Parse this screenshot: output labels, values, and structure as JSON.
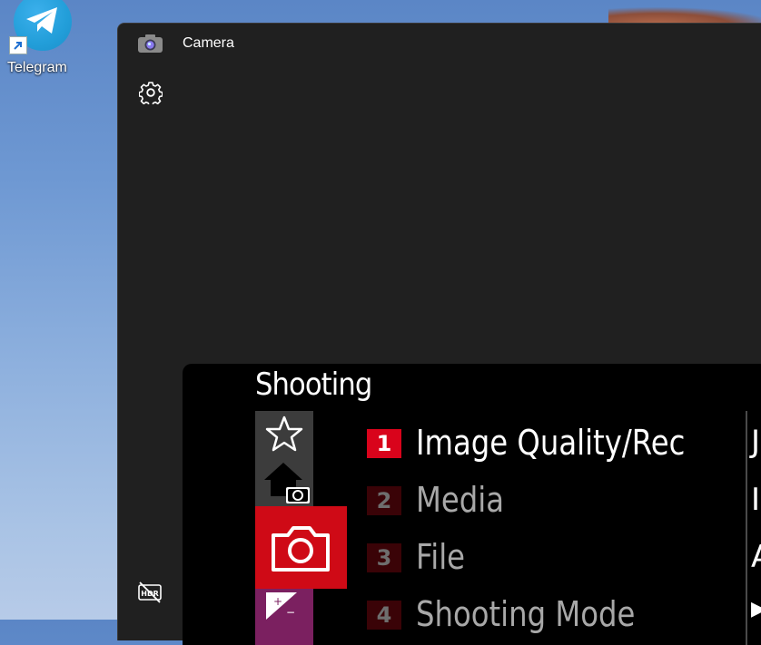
{
  "desktop": {
    "telegram_label": "Telegram"
  },
  "window": {
    "title": "Camera",
    "icons": {
      "app": "camera-app-icon",
      "settings": "gear-icon",
      "hdr": "hdr-off-icon"
    }
  },
  "viewfinder": {
    "menu_title": "Shooting",
    "categories": [
      "star-icon",
      "home-camera-icon",
      "camera-icon",
      "exposure-icon"
    ],
    "rows": [
      {
        "num": "1",
        "label": "Image Quality/Rec"
      },
      {
        "num": "2",
        "label": "Media"
      },
      {
        "num": "3",
        "label": "File"
      },
      {
        "num": "4",
        "label": "Shooting Mode"
      }
    ],
    "peek": [
      "J",
      "I",
      "A",
      "▶"
    ]
  },
  "colors": {
    "accent_red": "#d9031b",
    "window_bg": "#202020",
    "telegram_blue": "#229ed9"
  }
}
